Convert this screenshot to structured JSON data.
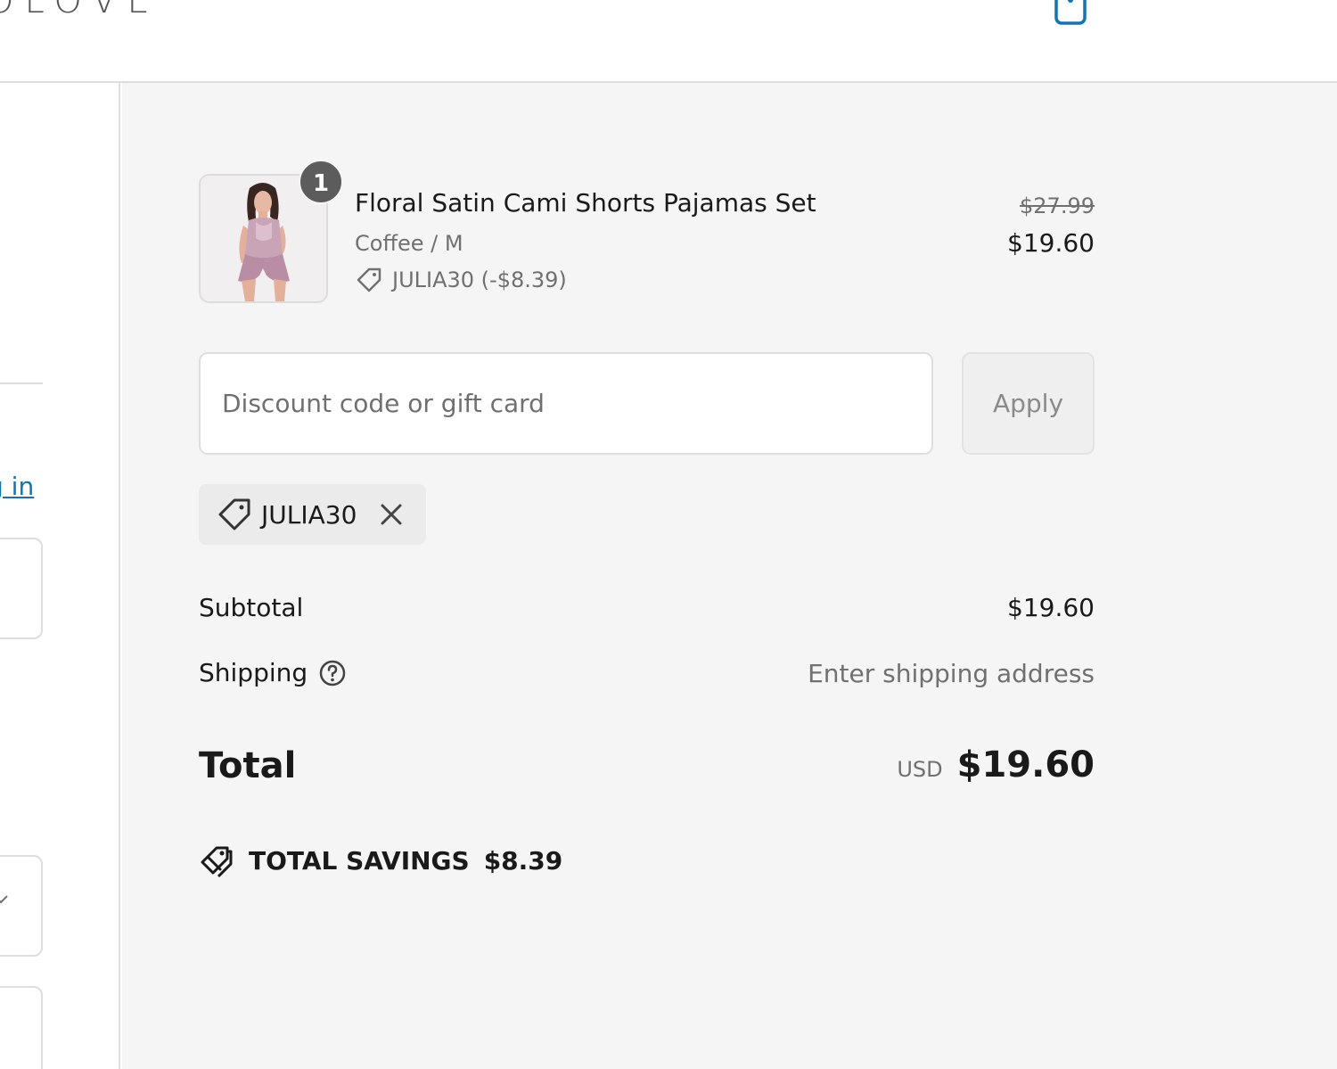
{
  "header": {
    "logo_text": "OLOVE"
  },
  "left": {
    "login_link": "g in"
  },
  "product": {
    "name": "Floral Satin Cami Shorts Pajamas Set",
    "variant": "Coffee / M",
    "discount_line": "JULIA30 (-$8.39)",
    "quantity": "1",
    "price_original": "$27.99",
    "price_current": "$19.60"
  },
  "discount_form": {
    "placeholder": "Discount code or gift card",
    "apply_label": "Apply"
  },
  "applied_code": {
    "label": "JULIA30"
  },
  "totals": {
    "subtotal_label": "Subtotal",
    "subtotal_value": "$19.60",
    "shipping_label": "Shipping",
    "shipping_value": "Enter shipping address",
    "total_label": "Total",
    "currency": "USD",
    "total_value": "$19.60",
    "savings_label": "TOTAL SAVINGS",
    "savings_value": "$8.39"
  },
  "colors": {
    "link": "#1773b0",
    "summary_bg": "#f5f5f5",
    "muted_text": "#707070"
  }
}
